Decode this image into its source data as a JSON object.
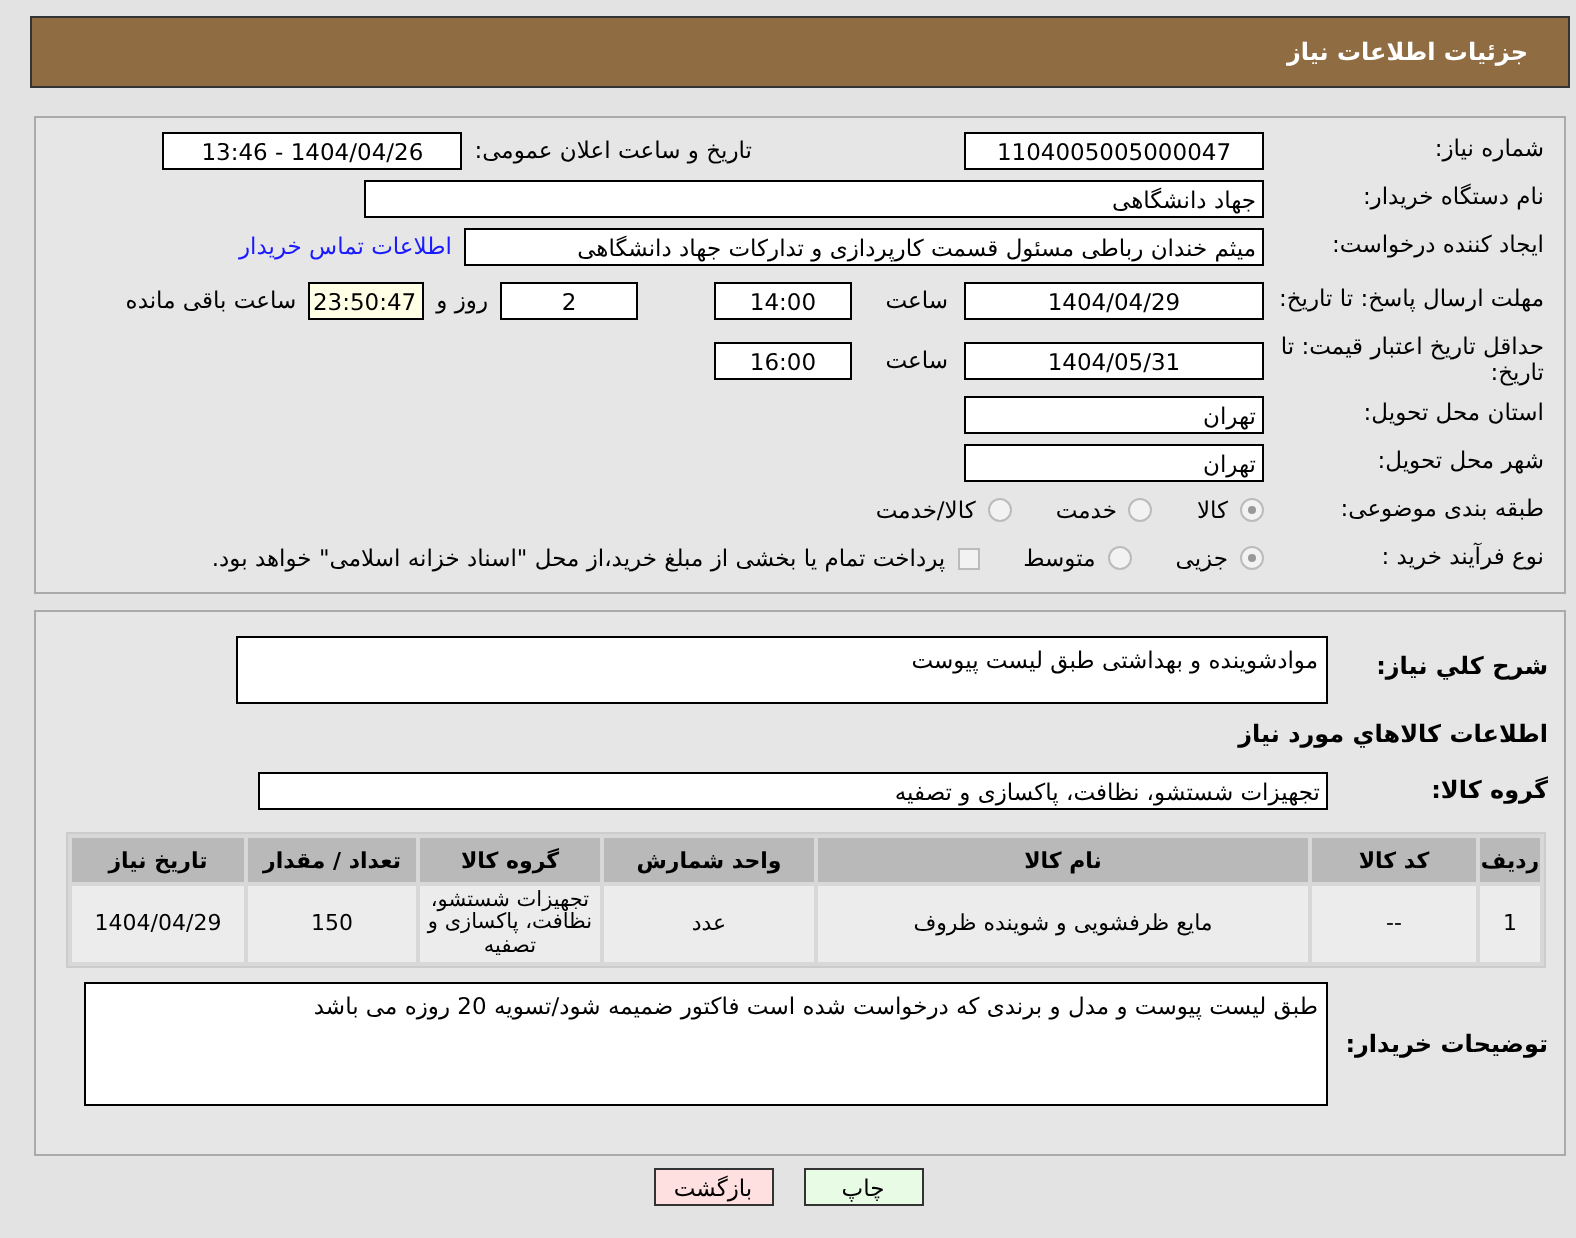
{
  "header": {
    "title": "جزئیات اطلاعات نیاز"
  },
  "need_number": {
    "label": "شماره نیاز:",
    "value": "1104005005000047"
  },
  "announce": {
    "label": "تاریخ و ساعت اعلان عمومی:",
    "value": "1404/04/26 - 13:46"
  },
  "buyer_org": {
    "label": "نام دستگاه خریدار:",
    "value": "جهاد دانشگاهی"
  },
  "creator": {
    "label": "ایجاد کننده درخواست:",
    "value": "میثم خندان رباطی مسئول قسمت کارپردازی و تدارکات جهاد دانشگاهی",
    "link": "اطلاعات تماس خریدار"
  },
  "deadline": {
    "label": "مهلت ارسال پاسخ: تا تاریخ:",
    "date": "1404/04/29",
    "time_label": "ساعت",
    "time": "14:00",
    "days": "2",
    "days_label": "روز و",
    "remaining": "23:50:47",
    "remaining_label": "ساعت باقی مانده"
  },
  "validity": {
    "label": "حداقل تاریخ اعتبار قیمت: تا تاریخ:",
    "date": "1404/05/31",
    "time_label": "ساعت",
    "time": "16:00"
  },
  "province": {
    "label": "استان محل تحویل:",
    "value": "تهران"
  },
  "city": {
    "label": "شهر محل تحویل:",
    "value": "تهران"
  },
  "category": {
    "label": "طبقه بندی موضوعی:",
    "options": [
      {
        "label": "کالا",
        "selected": true
      },
      {
        "label": "خدمت",
        "selected": false
      },
      {
        "label": "کالا/خدمت",
        "selected": false
      }
    ]
  },
  "process": {
    "label": "نوع فرآیند خرید :",
    "options": [
      {
        "label": "جزیی",
        "selected": true
      },
      {
        "label": "متوسط",
        "selected": false
      }
    ],
    "payment": {
      "label": "پرداخت تمام یا بخشی از مبلغ خرید،از محل \"اسناد خزانه اسلامی\" خواهد بود.",
      "checked": false
    }
  },
  "description": {
    "label": "شرح کلي نياز:",
    "value": "موادشوینده و بهداشتی طبق لیست پیوست"
  },
  "goods_title": "اطلاعات کالاهاي مورد نياز",
  "goods_group": {
    "label": "گروه کالا:",
    "value": "تجهیزات شستشو، نظافت، پاکسازی و تصفیه"
  },
  "table": {
    "columns": [
      "ردیف",
      "کد کالا",
      "نام کالا",
      "واحد شمارش",
      "گروه کالا",
      "تعداد / مقدار",
      "تاریخ نیاز"
    ],
    "rows": [
      [
        "1",
        "--",
        "مایع ظرفشویی و شوینده ظروف",
        "عدد",
        "تجهیزات شستشو، نظافت، پاکسازی و تصفیه",
        "150",
        "1404/04/29"
      ]
    ]
  },
  "notes": {
    "label": "توضیحات خریدار:",
    "value": "طبق لیست پیوست و مدل و برندی که درخواست شده است فاکتور ضمیمه شود/تسویه 20 روزه می باشد"
  },
  "buttons": [
    {
      "label": "چاپ",
      "kind": "print"
    },
    {
      "label": "بازگشت",
      "kind": "back"
    }
  ]
}
